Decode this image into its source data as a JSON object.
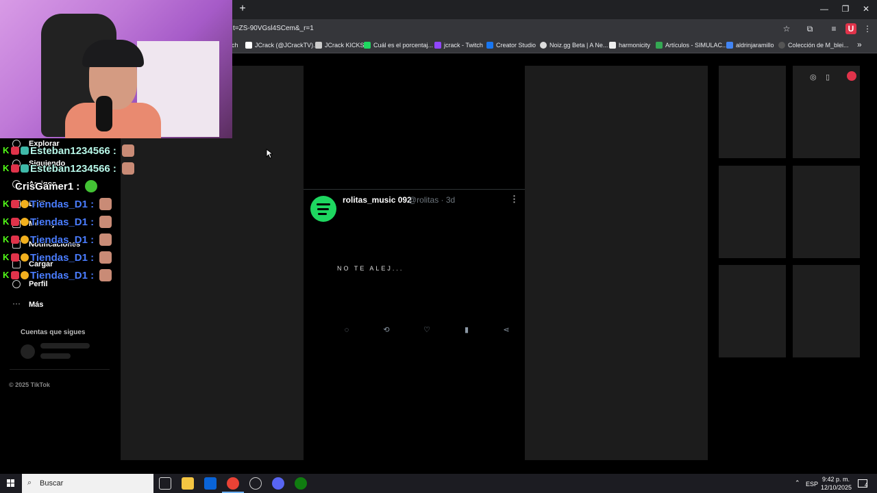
{
  "browser": {
    "new_tab": "+",
    "url": "t=ZS-90VGsl4SCem&_r=1",
    "window_controls": [
      "—",
      "❐",
      "✕"
    ],
    "bookmarks": [
      {
        "label": "ch",
        "color": "#888888"
      },
      {
        "label": "JCrack (@JCrackTV)...",
        "color": "#ffffff"
      },
      {
        "label": "JCrack KICKS",
        "color": "#cccccc"
      },
      {
        "label": "Cuál es el porcentaj...",
        "color": "#1ed760"
      },
      {
        "label": "jcrack - Twitch",
        "color": "#9146ff"
      },
      {
        "label": "Creator Studio",
        "color": "#1877f2"
      },
      {
        "label": "Noiz.gg Beta | A Ne...",
        "color": "#dddddd"
      },
      {
        "label": "harmonicity",
        "color": "#eeeeee"
      },
      {
        "label": "Artículos - SIMULAC...",
        "color": "#34a853"
      },
      {
        "label": "aldrinjaramillo",
        "color": "#4285f4"
      },
      {
        "label": "Colección de M_blei...",
        "color": "#555555"
      }
    ],
    "more": "»"
  },
  "sidebar": {
    "items": [
      "Explorar",
      "Siguiendo",
      "Amigos",
      "LIVE",
      "Mensajes",
      "Notificaciones",
      "Cargar",
      "Perfil",
      "Más"
    ],
    "following_title": "Cuentas que sigues",
    "copyright": "© 2025 TikTok"
  },
  "chat": [
    {
      "user": "Esteban1234566 :",
      "color": "#b7f7e8"
    },
    {
      "user": "Esteban1234566 :",
      "color": "#b7f7e8"
    },
    {
      "user": "CrisGamer1 :",
      "color": "#ffffff"
    },
    {
      "user": "Tiendas_D1 :",
      "color": "#4a7dff"
    },
    {
      "user": "Tiendas_D1 :",
      "color": "#4a7dff"
    },
    {
      "user": "Tiendas_D1 :",
      "color": "#4a7dff"
    },
    {
      "user": "Tiendas_D1 :",
      "color": "#4a7dff"
    },
    {
      "user": "Tiendas_D1 :",
      "color": "#4a7dff"
    }
  ],
  "tweet": {
    "name": "rolitas_music 092",
    "handle": "@rolitas · 3d",
    "text": "NO TE ALEJ...",
    "more": "⋮"
  },
  "taskbar": {
    "search_placeholder": "Buscar",
    "lang": "ESP",
    "time": "9:42 p. m.",
    "date": "12/10/2025",
    "notifications": "4"
  }
}
